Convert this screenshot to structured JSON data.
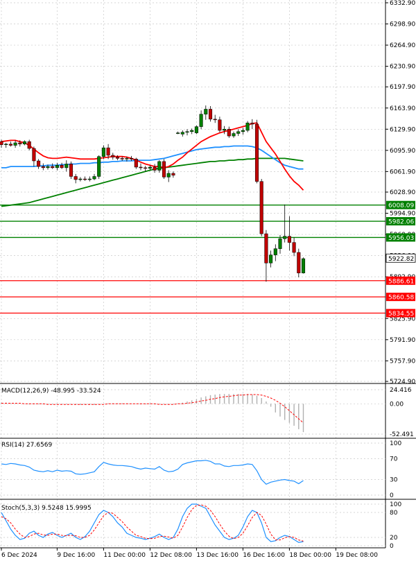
{
  "chart_data": {
    "type": "candlestick",
    "symbol_timeframe": "",
    "price_axis": {
      "min": 5724.9,
      "max": 6332.9,
      "ticks": [
        "6332.90",
        "6298.90",
        "6264.90",
        "6230.90",
        "6197.90",
        "6163.90",
        "6129.90",
        "6095.90",
        "6061.90",
        "6028.90",
        "5994.90",
        "5960.90",
        "5926.90",
        "5892.90",
        "5825.90",
        "5791.90",
        "5757.90",
        "5724.90"
      ]
    },
    "time_axis": {
      "labels": [
        {
          "text": "6 Dec 2024",
          "index": 0
        },
        {
          "text": "9 Dec 16:00",
          "index": 12
        },
        {
          "text": "11 Dec 00:00",
          "index": 22
        },
        {
          "text": "12 Dec 08:00",
          "index": 32
        },
        {
          "text": "13 Dec 16:00",
          "index": 42
        },
        {
          "text": "16 Dec 16:00",
          "index": 52
        },
        {
          "text": "18 Dec 00:00",
          "index": 62
        },
        {
          "text": "19 Dec 08:00",
          "index": 72
        }
      ]
    },
    "horizontal_levels": [
      {
        "value": 6008.09,
        "label": "6008.09",
        "color": "#008000"
      },
      {
        "value": 5982.06,
        "label": "5982.06",
        "color": "#008000"
      },
      {
        "value": 5956.03,
        "label": "5956.03",
        "color": "#008000"
      },
      {
        "value": 5886.61,
        "label": "5886.61",
        "color": "#ff0000"
      },
      {
        "value": 5860.58,
        "label": "5860.58",
        "color": "#ff0000"
      },
      {
        "value": 5834.55,
        "label": "5834.55",
        "color": "#ff0000"
      }
    ],
    "current_price": {
      "value": 5922.82,
      "label": "5922.82"
    },
    "candles": [
      {
        "o": 6110,
        "h": 6113,
        "l": 6100,
        "c": 6105
      },
      {
        "o": 6105,
        "h": 6108,
        "l": 6100,
        "c": 6106
      },
      {
        "o": 6106,
        "h": 6110,
        "l": 6102,
        "c": 6104
      },
      {
        "o": 6104,
        "h": 6112,
        "l": 6100,
        "c": 6108
      },
      {
        "o": 6108,
        "h": 6112,
        "l": 6102,
        "c": 6106
      },
      {
        "o": 6106,
        "h": 6112,
        "l": 6104,
        "c": 6110
      },
      {
        "o": 6110,
        "h": 6113,
        "l": 6096,
        "c": 6099
      },
      {
        "o": 6099,
        "h": 6102,
        "l": 6070,
        "c": 6079
      },
      {
        "o": 6079,
        "h": 6082,
        "l": 6066,
        "c": 6070
      },
      {
        "o": 6070,
        "h": 6075,
        "l": 6064,
        "c": 6068
      },
      {
        "o": 6068,
        "h": 6073,
        "l": 6065,
        "c": 6070
      },
      {
        "o": 6070,
        "h": 6075,
        "l": 6066,
        "c": 6068
      },
      {
        "o": 6068,
        "h": 6076,
        "l": 6064,
        "c": 6072
      },
      {
        "o": 6072,
        "h": 6076,
        "l": 6066,
        "c": 6068
      },
      {
        "o": 6068,
        "h": 6080,
        "l": 6062,
        "c": 6074
      },
      {
        "o": 6074,
        "h": 6078,
        "l": 6050,
        "c": 6054
      },
      {
        "o": 6054,
        "h": 6058,
        "l": 6043,
        "c": 6049
      },
      {
        "o": 6049,
        "h": 6053,
        "l": 6046,
        "c": 6050
      },
      {
        "o": 6050,
        "h": 6054,
        "l": 6047,
        "c": 6049
      },
      {
        "o": 6049,
        "h": 6054,
        "l": 6046,
        "c": 6050
      },
      {
        "o": 6050,
        "h": 6058,
        "l": 6048,
        "c": 6054
      },
      {
        "o": 6054,
        "h": 6088,
        "l": 6050,
        "c": 6086
      },
      {
        "o": 6086,
        "h": 6104,
        "l": 6082,
        "c": 6100
      },
      {
        "o": 6100,
        "h": 6106,
        "l": 6082,
        "c": 6088
      },
      {
        "o": 6088,
        "h": 6092,
        "l": 6081,
        "c": 6085
      },
      {
        "o": 6085,
        "h": 6088,
        "l": 6080,
        "c": 6083
      },
      {
        "o": 6083,
        "h": 6086,
        "l": 6079,
        "c": 6082
      },
      {
        "o": 6082,
        "h": 6086,
        "l": 6078,
        "c": 6083
      },
      {
        "o": 6083,
        "h": 6087,
        "l": 6079,
        "c": 6082
      },
      {
        "o": 6082,
        "h": 6084,
        "l": 6066,
        "c": 6069
      },
      {
        "o": 6069,
        "h": 6075,
        "l": 6064,
        "c": 6068
      },
      {
        "o": 6068,
        "h": 6071,
        "l": 6062,
        "c": 6067
      },
      {
        "o": 6067,
        "h": 6072,
        "l": 6064,
        "c": 6069
      },
      {
        "o": 6069,
        "h": 6074,
        "l": 6060,
        "c": 6064
      },
      {
        "o": 6064,
        "h": 6080,
        "l": 6060,
        "c": 6078
      },
      {
        "o": 6078,
        "h": 6082,
        "l": 6050,
        "c": 6053
      },
      {
        "o": 6053,
        "h": 6064,
        "l": 6045,
        "c": 6059
      },
      {
        "o": 6059,
        "h": 6062,
        "l": 6052,
        "c": 6056
      },
      {
        "o": 6124,
        "h": 6126,
        "l": 6122,
        "c": 6124
      },
      {
        "o": 6122,
        "h": 6128,
        "l": 6118,
        "c": 6125
      },
      {
        "o": 6125,
        "h": 6130,
        "l": 6120,
        "c": 6126
      },
      {
        "o": 6126,
        "h": 6131,
        "l": 6122,
        "c": 6128
      },
      {
        "o": 6124,
        "h": 6136,
        "l": 6122,
        "c": 6134
      },
      {
        "o": 6134,
        "h": 6160,
        "l": 6130,
        "c": 6154
      },
      {
        "o": 6154,
        "h": 6168,
        "l": 6145,
        "c": 6162
      },
      {
        "o": 6162,
        "h": 6167,
        "l": 6142,
        "c": 6146
      },
      {
        "o": 6146,
        "h": 6153,
        "l": 6140,
        "c": 6145
      },
      {
        "o": 6145,
        "h": 6150,
        "l": 6125,
        "c": 6128
      },
      {
        "o": 6128,
        "h": 6135,
        "l": 6122,
        "c": 6130
      },
      {
        "o": 6130,
        "h": 6134,
        "l": 6116,
        "c": 6119
      },
      {
        "o": 6119,
        "h": 6126,
        "l": 6116,
        "c": 6123
      },
      {
        "o": 6123,
        "h": 6130,
        "l": 6119,
        "c": 6126
      },
      {
        "o": 6126,
        "h": 6132,
        "l": 6121,
        "c": 6128
      },
      {
        "o": 6128,
        "h": 6143,
        "l": 6125,
        "c": 6140
      },
      {
        "o": 6140,
        "h": 6146,
        "l": 6130,
        "c": 6138
      },
      {
        "o": 6138,
        "h": 6145,
        "l": 6043,
        "c": 6046
      },
      {
        "o": 6046,
        "h": 6050,
        "l": 5958,
        "c": 5962
      },
      {
        "o": 5962,
        "h": 5968,
        "l": 5885,
        "c": 5915
      },
      {
        "o": 5915,
        "h": 5935,
        "l": 5908,
        "c": 5928
      },
      {
        "o": 5928,
        "h": 5945,
        "l": 5918,
        "c": 5938
      },
      {
        "o": 5938,
        "h": 5960,
        "l": 5930,
        "c": 5954
      },
      {
        "o": 5954,
        "h": 6009,
        "l": 5948,
        "c": 5958
      },
      {
        "o": 5958,
        "h": 5990,
        "l": 5935,
        "c": 5948
      },
      {
        "o": 5948,
        "h": 5956,
        "l": 5926,
        "c": 5932
      },
      {
        "o": 5932,
        "h": 5938,
        "l": 5892,
        "c": 5899
      },
      {
        "o": 5899,
        "h": 5924,
        "l": 5898,
        "c": 5922
      }
    ],
    "ma_red": [
      6110,
      6111,
      6112,
      6112,
      6110,
      6108,
      6104,
      6098,
      6092,
      6087,
      6084,
      6083,
      6083,
      6084,
      6085,
      6084,
      6083,
      6082,
      6082,
      6082,
      6082,
      6083,
      6084,
      6085,
      6086,
      6086,
      6086,
      6085,
      6083,
      6080,
      6077,
      6074,
      6072,
      6070,
      6070,
      6068,
      6070,
      6074,
      6080,
      6085,
      6092,
      6098,
      6104,
      6110,
      6114,
      6118,
      6121,
      6124,
      6126,
      6128,
      6130,
      6132,
      6134,
      6136,
      6139,
      6140,
      6125,
      6110,
      6100,
      6090,
      6078,
      6066,
      6055,
      6046,
      6040,
      6032
    ],
    "ma_blue": [
      6068,
      6068,
      6070,
      6070,
      6070,
      6070,
      6070,
      6070,
      6071,
      6071,
      6072,
      6072,
      6072,
      6073,
      6073,
      6074,
      6074,
      6075,
      6075,
      6075,
      6076,
      6076,
      6077,
      6077,
      6078,
      6078,
      6079,
      6079,
      6079,
      6080,
      6080,
      6080,
      6080,
      6081,
      6082,
      6083,
      6085,
      6087,
      6089,
      6091,
      6093,
      6095,
      6097,
      6098,
      6099,
      6100,
      6101,
      6101,
      6102,
      6102,
      6103,
      6103,
      6103,
      6103,
      6102,
      6100,
      6096,
      6091,
      6086,
      6081,
      6076,
      6072,
      6070,
      6068,
      6066,
      6066
    ],
    "ma_green": [
      6006,
      6007,
      6008,
      6009,
      6010,
      6011,
      6012,
      6014,
      6016,
      6018,
      6020,
      6022,
      6024,
      6026,
      6028,
      6030,
      6032,
      6034,
      6036,
      6038,
      6040,
      6042,
      6044,
      6046,
      6048,
      6050,
      6052,
      6054,
      6056,
      6058,
      6060,
      6062,
      6064,
      6066,
      6067,
      6068,
      6069,
      6070,
      6071,
      6072,
      6073,
      6074,
      6075,
      6076,
      6077,
      6078,
      6078,
      6079,
      6079,
      6080,
      6080,
      6081,
      6081,
      6082,
      6082,
      6083,
      6083,
      6083,
      6083,
      6083,
      6083,
      6083,
      6082,
      6081,
      6080,
      6079
    ],
    "macd": {
      "label": "MACD(12,26,9) -48.995 -33.524",
      "ticks": [
        "24.416",
        "0.00",
        "-52.491"
      ],
      "min": -52.491,
      "max": 24.416,
      "hist": [
        2,
        2,
        1,
        1,
        0,
        0,
        -1,
        -1,
        -1,
        -1,
        -1,
        -1,
        -1,
        -1,
        -1,
        -1,
        -2,
        -2,
        -2,
        -2,
        -2,
        -1,
        0,
        1,
        1,
        1,
        1,
        1,
        0,
        0,
        -1,
        -1,
        -1,
        -1,
        -1,
        -1,
        -1,
        -1,
        1,
        2,
        4,
        6,
        8,
        11,
        13,
        15,
        16,
        17,
        17,
        17,
        17,
        17,
        17,
        17,
        16,
        14,
        10,
        4,
        -5,
        -15,
        -22,
        -28,
        -33,
        -38,
        -44,
        -49
      ],
      "signal": [
        1,
        1,
        1,
        1,
        1,
        0,
        0,
        0,
        0,
        0,
        -1,
        -1,
        -1,
        -1,
        -1,
        -1,
        -1,
        -1,
        -1,
        -1,
        -1,
        -1,
        -1,
        0,
        0,
        0,
        0,
        0,
        0,
        0,
        0,
        0,
        0,
        0,
        -1,
        -1,
        -1,
        -1,
        0,
        0,
        1,
        2,
        3,
        5,
        6,
        8,
        9,
        11,
        12,
        13,
        14,
        15,
        15,
        16,
        16,
        16,
        15,
        13,
        10,
        6,
        1,
        -5,
        -12,
        -19,
        -26,
        -33
      ]
    },
    "rsi": {
      "label": "RSI(14) 27.6569",
      "ticks": [
        "100",
        "70",
        "30",
        "0"
      ],
      "min": 0,
      "max": 100,
      "values": [
        60,
        59,
        61,
        60,
        58,
        57,
        54,
        48,
        46,
        45,
        47,
        45,
        48,
        46,
        47,
        46,
        41,
        40,
        41,
        43,
        45,
        55,
        63,
        60,
        58,
        57,
        57,
        56,
        55,
        52,
        50,
        52,
        51,
        50,
        55,
        48,
        45,
        46,
        50,
        59,
        62,
        64,
        66,
        66,
        67,
        65,
        60,
        60,
        56,
        55,
        57,
        57,
        58,
        60,
        59,
        47,
        30,
        21,
        25,
        27,
        29,
        30,
        28,
        27,
        22,
        28
      ]
    },
    "stoch": {
      "label": "Stoch(5,3,3) 9.5248 15.9995",
      "ticks": [
        "100",
        "80",
        "20",
        "0"
      ],
      "min": 0,
      "max": 100,
      "k": [
        80,
        60,
        40,
        25,
        15,
        18,
        30,
        35,
        25,
        20,
        28,
        32,
        25,
        20,
        25,
        30,
        20,
        15,
        22,
        35,
        55,
        75,
        85,
        80,
        70,
        55,
        45,
        30,
        25,
        20,
        18,
        15,
        18,
        22,
        28,
        20,
        15,
        20,
        40,
        70,
        90,
        100,
        100,
        95,
        90,
        70,
        50,
        35,
        20,
        15,
        18,
        25,
        45,
        70,
        85,
        80,
        55,
        20,
        10,
        12,
        20,
        25,
        22,
        15,
        8,
        10
      ],
      "d": [
        70,
        65,
        55,
        40,
        28,
        20,
        22,
        28,
        30,
        26,
        25,
        28,
        28,
        25,
        24,
        25,
        24,
        20,
        20,
        25,
        38,
        55,
        72,
        80,
        78,
        68,
        58,
        45,
        35,
        25,
        22,
        18,
        17,
        18,
        22,
        23,
        21,
        18,
        25,
        45,
        68,
        87,
        97,
        98,
        95,
        85,
        70,
        52,
        35,
        23,
        17,
        20,
        30,
        48,
        68,
        80,
        73,
        52,
        28,
        14,
        14,
        19,
        22,
        20,
        14,
        11
      ]
    }
  },
  "colors": {
    "bull_body": "#008000",
    "bear_body": "#c00000",
    "ma_red": "#ff0000",
    "ma_blue": "#1e90ff",
    "ma_green": "#008000",
    "grid": "#c8c8c8",
    "indicator_line": "#1e90ff",
    "signal_line": "#ff0000",
    "macd_hist": "#b0b0b0"
  }
}
